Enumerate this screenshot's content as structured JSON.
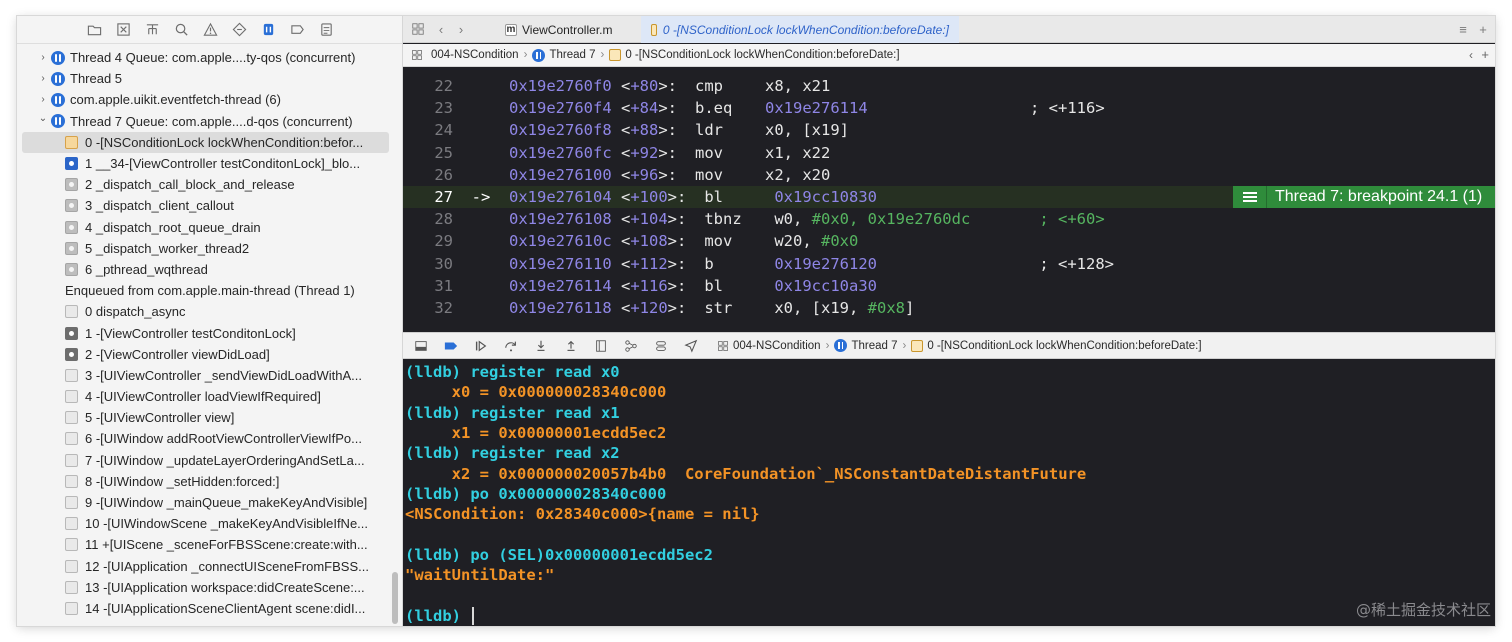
{
  "navigator": {
    "toolbar_icons": [
      "folder-icon",
      "source-control-icon",
      "hierarchy-icon",
      "search-icon",
      "warning-icon",
      "test-diamond-icon",
      "debug-icon",
      "breakpoint-icon",
      "report-icon"
    ],
    "threads_top": [
      {
        "label": "Thread 4 Queue: com.apple....ty-qos (concurrent)",
        "expanded": false
      },
      {
        "label": "Thread 5",
        "expanded": false
      },
      {
        "label": "com.apple.uikit.eventfetch-thread (6)",
        "expanded": false
      },
      {
        "label": "Thread 7 Queue: com.apple....d-qos (concurrent)",
        "expanded": true
      }
    ],
    "thread7_frames": [
      {
        "label": "0 -[NSConditionLock lockWhenCondition:befor...",
        "icon": "orange",
        "selected": true
      },
      {
        "label": "1 __34-[ViewController testConditonLock]_blo...",
        "icon": "user"
      },
      {
        "label": "2 _dispatch_call_block_and_release",
        "icon": "system"
      },
      {
        "label": "3 _dispatch_client_callout",
        "icon": "system"
      },
      {
        "label": "4 _dispatch_root_queue_drain",
        "icon": "system"
      },
      {
        "label": "5 _dispatch_worker_thread2",
        "icon": "system"
      },
      {
        "label": "6 _pthread_wqthread",
        "icon": "system"
      }
    ],
    "enqueued_label": "Enqueued from com.apple.main-thread (Thread 1)",
    "enqueued_frames": [
      {
        "label": "0 dispatch_async",
        "icon": "dim"
      },
      {
        "label": "1 -[ViewController testConditonLock]",
        "icon": "dimuser"
      },
      {
        "label": "2 -[ViewController viewDidLoad]",
        "icon": "dimuser"
      },
      {
        "label": "3 -[UIViewController _sendViewDidLoadWithA...",
        "icon": "dim"
      },
      {
        "label": "4 -[UIViewController loadViewIfRequired]",
        "icon": "dim"
      },
      {
        "label": "5 -[UIViewController view]",
        "icon": "dim"
      },
      {
        "label": "6 -[UIWindow addRootViewControllerViewIfPo...",
        "icon": "dim"
      },
      {
        "label": "7 -[UIWindow _updateLayerOrderingAndSetLa...",
        "icon": "dim"
      },
      {
        "label": "8 -[UIWindow _setHidden:forced:]",
        "icon": "dim"
      },
      {
        "label": "9 -[UIWindow _mainQueue_makeKeyAndVisible]",
        "icon": "dim"
      },
      {
        "label": "10 -[UIWindowScene _makeKeyAndVisibleIfNe...",
        "icon": "dim"
      },
      {
        "label": "11 +[UIScene _sceneForFBSScene:create:with...",
        "icon": "dim"
      },
      {
        "label": "12 -[UIApplication _connectUISceneFromFBSS...",
        "icon": "dim"
      },
      {
        "label": "13 -[UIApplication workspace:didCreateScene:...",
        "icon": "dim"
      },
      {
        "label": "14 -[UIApplicationSceneClientAgent scene:didI...",
        "icon": "dim"
      }
    ]
  },
  "tabs": [
    {
      "label": "ViewController.m",
      "active": false
    },
    {
      "label": "0 -[NSConditionLock lockWhenCondition:beforeDate:]",
      "active": true
    }
  ],
  "jumpbar": {
    "project": "004-NSCondition",
    "thread": "Thread 7",
    "frame": "0 -[NSConditionLock lockWhenCondition:beforeDate:]"
  },
  "code": {
    "current_line": 27,
    "lines": [
      {
        "ln": "22",
        "addr": "0x19e2760f0",
        "off": "+80",
        "mnem": "cmp",
        "ops": [
          [
            "x8, x21",
            "opnd"
          ]
        ],
        "comment": ""
      },
      {
        "ln": "23",
        "addr": "0x19e2760f4",
        "off": "+84",
        "mnem": "b.eq",
        "ops": [
          [
            "0x19e276114",
            "addr"
          ]
        ],
        "comment": "; <+116>"
      },
      {
        "ln": "24",
        "addr": "0x19e2760f8",
        "off": "+88",
        "mnem": "ldr",
        "ops": [
          [
            "x0, [x19]",
            "opnd"
          ]
        ],
        "comment": ""
      },
      {
        "ln": "25",
        "addr": "0x19e2760fc",
        "off": "+92",
        "mnem": "mov",
        "ops": [
          [
            "x1, x22",
            "opnd"
          ]
        ],
        "comment": ""
      },
      {
        "ln": "26",
        "addr": "0x19e276100",
        "off": "+96",
        "mnem": "mov",
        "ops": [
          [
            "x2, x20",
            "opnd"
          ]
        ],
        "comment": ""
      },
      {
        "ln": "27",
        "addr": "0x19e276104",
        "off": "+100",
        "mnem": "bl",
        "ops": [
          [
            "0x19cc10830",
            "addr"
          ]
        ],
        "comment": "",
        "arrow": "->"
      },
      {
        "ln": "28",
        "addr": "0x19e276108",
        "off": "+104",
        "mnem": "tbnz",
        "ops": [
          [
            "w0, ",
            "opnd"
          ],
          [
            "#0x0, 0x19e2760dc",
            "num"
          ]
        ],
        "comment": "; <+60>",
        "comment_green": true
      },
      {
        "ln": "29",
        "addr": "0x19e27610c",
        "off": "+108",
        "mnem": "mov",
        "ops": [
          [
            "w20, ",
            "opnd"
          ],
          [
            "#0x0",
            "num"
          ]
        ],
        "comment": ""
      },
      {
        "ln": "30",
        "addr": "0x19e276110",
        "off": "+112",
        "mnem": "b",
        "ops": [
          [
            "0x19e276120",
            "addr"
          ]
        ],
        "comment": "; <+128>"
      },
      {
        "ln": "31",
        "addr": "0x19e276114",
        "off": "+116",
        "mnem": "bl",
        "ops": [
          [
            "0x19cc10a30",
            "addr"
          ]
        ],
        "comment": ""
      },
      {
        "ln": "32",
        "addr": "0x19e276118",
        "off": "+120",
        "mnem": "str",
        "ops": [
          [
            "x0, [x19, ",
            "opnd"
          ],
          [
            "#0x8",
            "num"
          ],
          [
            "]",
            "opnd"
          ]
        ],
        "comment": ""
      }
    ],
    "breakpoint_annotation": "Thread 7: breakpoint 24.1 (1)"
  },
  "debugbar": {
    "project": "004-NSCondition",
    "thread": "Thread 7",
    "frame": "0 -[NSConditionLock lockWhenCondition:beforeDate:]"
  },
  "console": {
    "lines": [
      {
        "prompt": "(lldb) ",
        "cmd": "register read x0"
      },
      {
        "out": "     x0 = 0x000000028340c000"
      },
      {
        "prompt": "(lldb) ",
        "cmd": "register read x1"
      },
      {
        "out": "     x1 = 0x00000001ecdd5ec2"
      },
      {
        "prompt": "(lldb) ",
        "cmd": "register read x2"
      },
      {
        "out": "     x2 = 0x000000020057b4b0  CoreFoundation`_NSConstantDateDistantFuture"
      },
      {
        "prompt": "(lldb) ",
        "cmd": "po 0x000000028340c000"
      },
      {
        "out": "<NSCondition: 0x28340c000>{name = nil}"
      },
      {
        "out": ""
      },
      {
        "prompt": "(lldb) ",
        "cmd": "po (SEL)0x00000001ecdd5ec2"
      },
      {
        "out": "\"waitUntilDate:\""
      },
      {
        "out": ""
      },
      {
        "prompt": "(lldb) ",
        "cmd": ""
      }
    ],
    "watermark": "@稀土掘金技术社区"
  }
}
